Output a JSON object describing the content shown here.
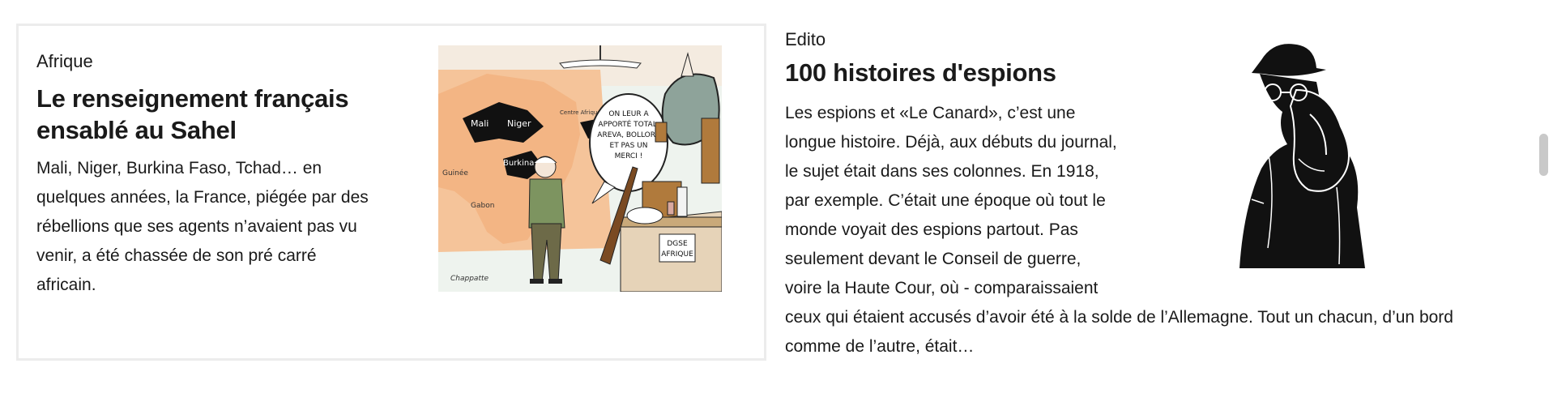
{
  "article_left": {
    "rubric": "Afrique",
    "title": "Le renseignement français ensablé au Sahel",
    "excerpt": "Mali, Niger, Burkina Faso, Tchad… en quelques années, la France, piégée par des rébellions que ses agents n’avaient pas vu venir, a été chassée de son pré carré africain.",
    "cartoon": {
      "map_labels": [
        "Mali",
        "Niger",
        "Burkina",
        "Guinée",
        "Gabon",
        "Centre Afrique"
      ],
      "speech_bubble": [
        "ON LEUR A",
        "APPORTÉ TOTAL,",
        "AREVA, BOLLORÉ",
        "ET PAS UN",
        "MERCI !"
      ],
      "box_label": [
        "DGSE",
        "AFRIQUE"
      ],
      "signature": "Chappatte"
    }
  },
  "article_right": {
    "rubric": "Edito",
    "title": "100 histoires d'espions",
    "excerpt": "Les espions et «Le Canard», c’est une longue histoire. Déjà, aux débuts du journal, le sujet était dans ses colonnes. En 1918, par exemple. C’était une époque où tout le monde voyait des espions partout. Pas seulement devant le Conseil de guerre, voire la Haute Cour, où - comparaissaient ceux qui étaient accusés d’avoir été à la solde de l’Allemagne. Tout un chacun, d’un bord comme de l’autre, était…"
  }
}
